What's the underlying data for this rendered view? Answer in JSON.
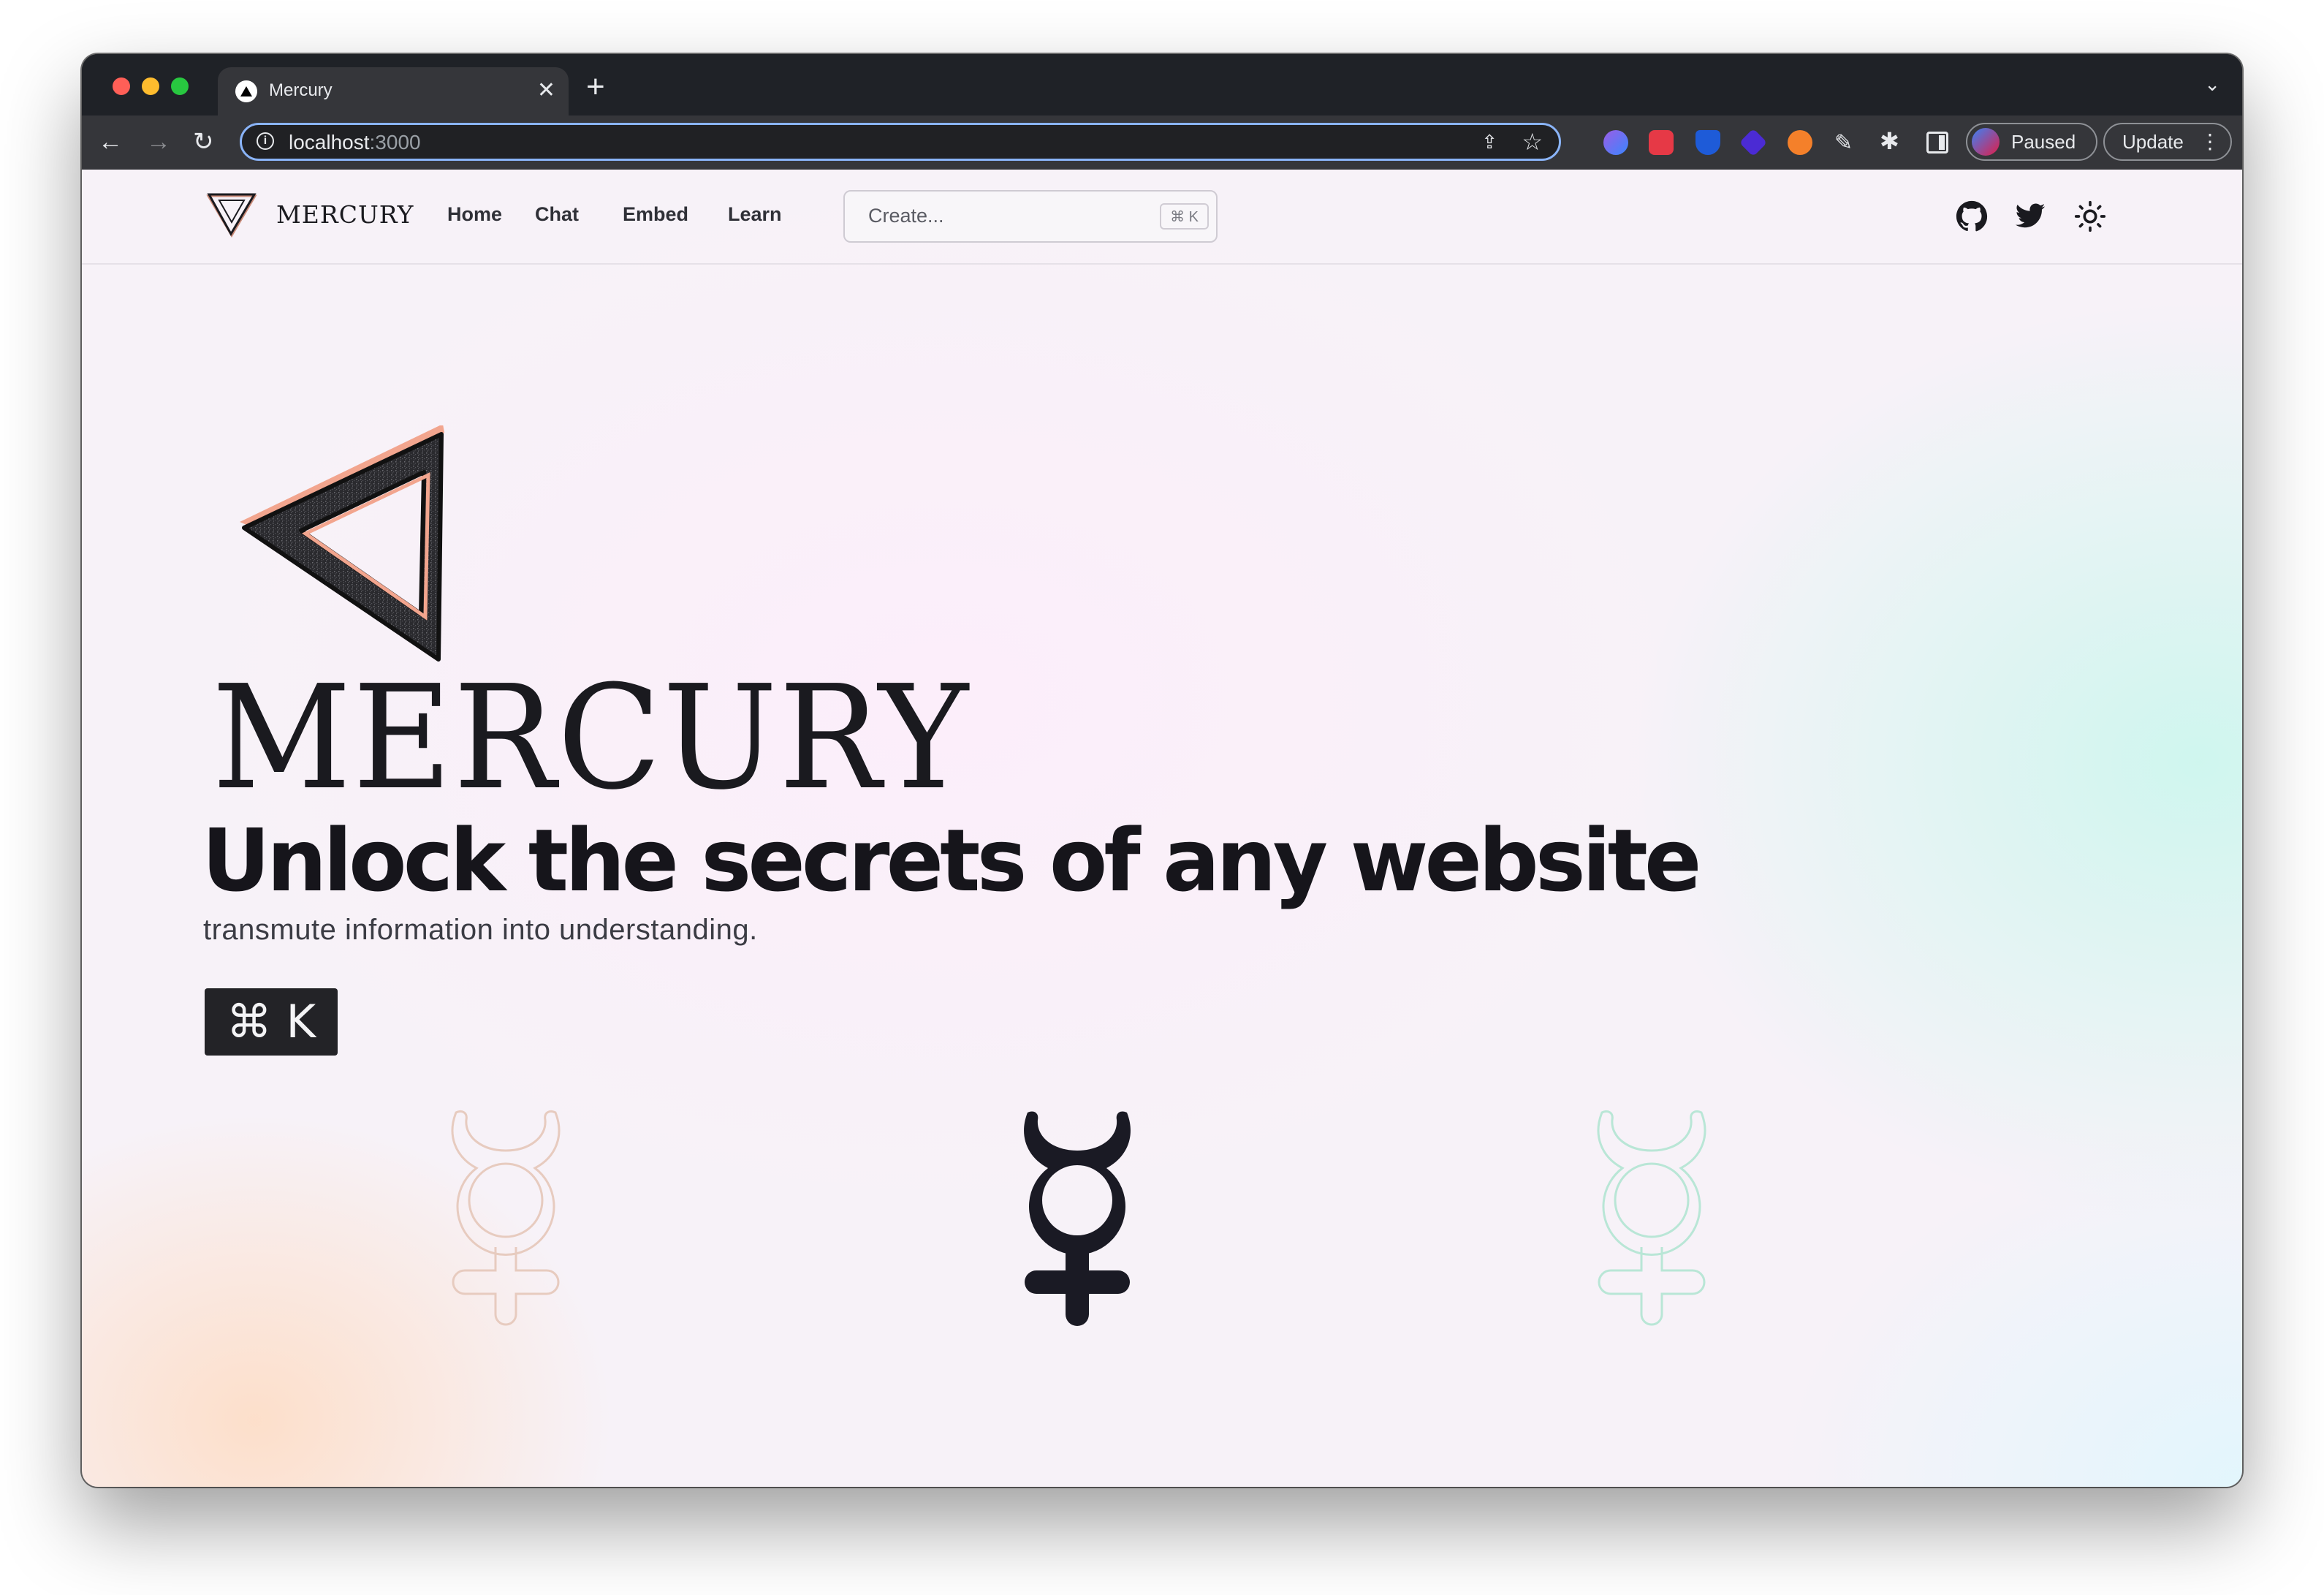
{
  "browser": {
    "tab_title": "Mercury",
    "new_tab": "+",
    "close_tab": "✕",
    "tab_menu": "⌄",
    "url_host": "localhost",
    "url_port": ":3000",
    "paused_label": "Paused",
    "update_label": "Update"
  },
  "navbar": {
    "brand": "MERCURY",
    "links": [
      "Home",
      "Chat",
      "Embed",
      "Learn"
    ],
    "search_placeholder": "Create...",
    "search_shortcut": "⌘ K"
  },
  "hero": {
    "wordmark": "MERCURY",
    "heading": "Unlock the secrets of any website",
    "subheading": "transmute information into understanding.",
    "shortcut": "⌘ K"
  },
  "colors": {
    "accent_peach": "#f2a58e",
    "ink": "#1a1a24",
    "mint_outline": "#b9e6d6",
    "peach_outline": "#e7cbbf"
  },
  "icons": [
    "github-icon",
    "twitter-icon",
    "sun-icon",
    "mercury-symbol-icon",
    "triangle-logo-icon"
  ]
}
